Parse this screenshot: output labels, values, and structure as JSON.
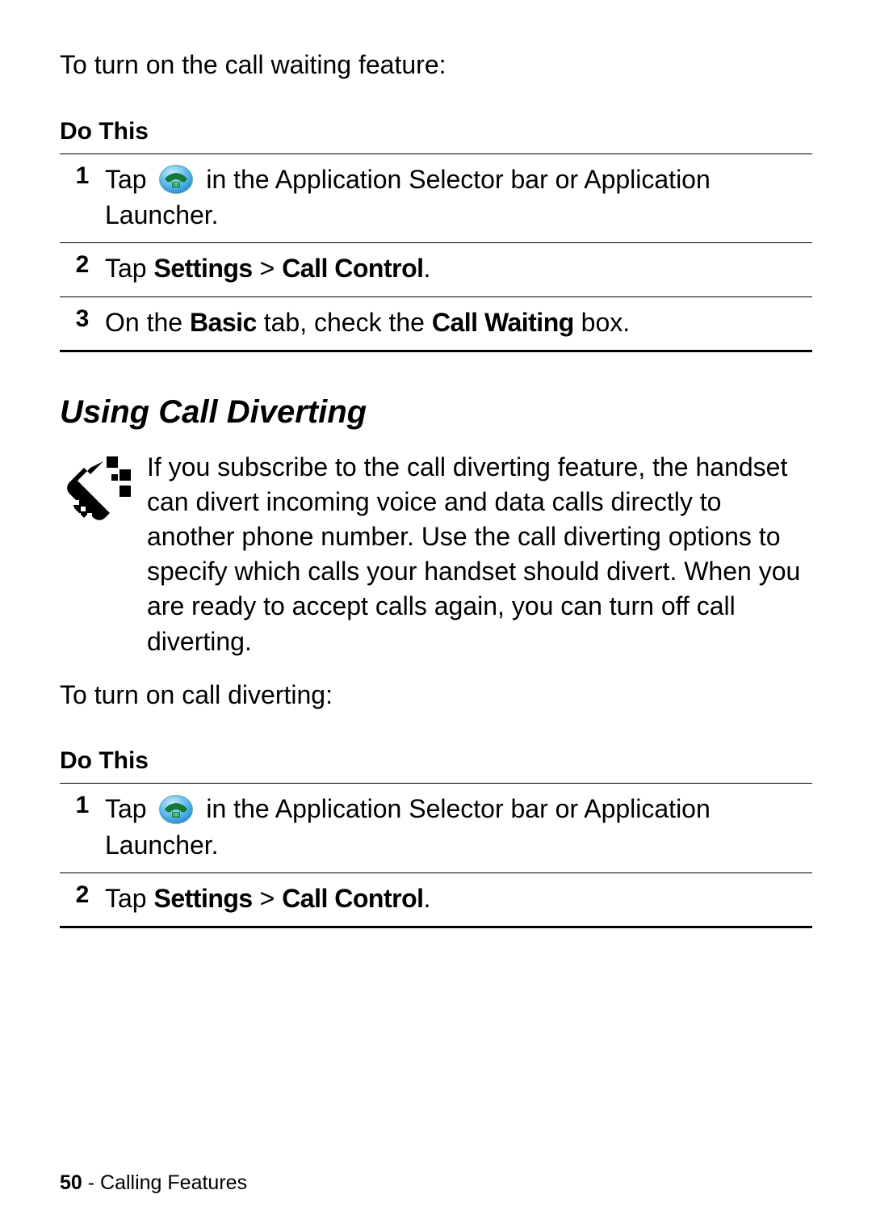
{
  "intro1": "To turn on the call waiting feature:",
  "doThis": "Do This",
  "steps1": {
    "row1": {
      "num": "1",
      "pre": "Tap ",
      "post": " in the Application Selector bar or Application Launcher."
    },
    "row2": {
      "num": "2",
      "pre": "Tap ",
      "b1": "Settings",
      "mid": " > ",
      "b2": "Call Control",
      "post": "."
    },
    "row3": {
      "num": "3",
      "pre": "On the ",
      "b1": "Basic",
      "mid": " tab, check the ",
      "b2": "Call Waiting",
      "post": " box."
    }
  },
  "heading": "Using Call Diverting",
  "divertPara": "If you subscribe to the call diverting feature, the handset can divert incoming voice and data calls directly to another phone number. Use the call diverting options to specify which calls your handset should divert. When you are ready to accept calls again, you can turn off call diverting.",
  "intro2": "To turn on call diverting:",
  "steps2": {
    "row1": {
      "num": "1",
      "pre": "Tap ",
      "post": " in the Application Selector bar or Application Launcher."
    },
    "row2": {
      "num": "2",
      "pre": "Tap ",
      "b1": "Settings",
      "mid": " > ",
      "b2": "Call Control",
      "post": "."
    }
  },
  "footer": {
    "page": "50",
    "sep": " - ",
    "section": "Calling Features"
  }
}
